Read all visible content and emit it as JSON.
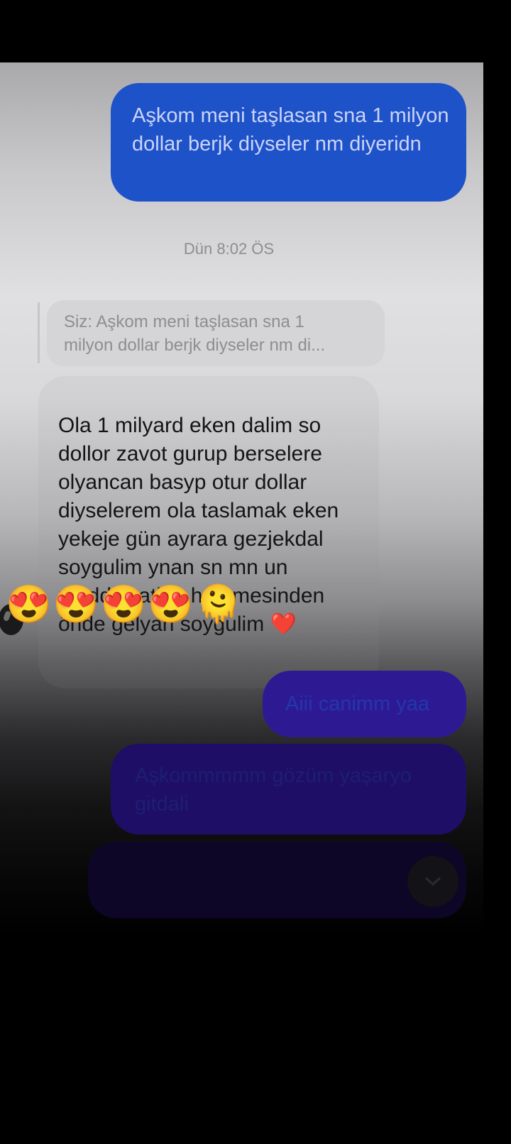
{
  "messages": {
    "first_sent": "Aşkom meni taşlasan sna 1 milyon dollar berjk diyseler nm diyeridn",
    "timestamp": "Dün 8:02 ÖS",
    "reply_preview": "Siz: Aşkom meni taşlasan sna 1\nmilyon dollar berjk diyseler nm di...",
    "received": "Ola 1 milyard eken dalim so\ndollor zavot gurup berselere\nolyancan basyp otur dollar\ndiyselerem ola taslamak eken\nyekeje gün ayrara gezjekdal\nsoygulim ynan sn mn un\nmaddy zatlan hemmesinden\nönde gelyan soygulim ❤️",
    "reactions": "😍😍😍😍🫠",
    "sent_2": "Aiii canimm yaa",
    "sent_3": "Aşkommmmm gözüm yaşaryo gitdali"
  },
  "colors": {
    "sent_bubble": "#1d52c9",
    "received_text": "#141414",
    "background": "#000000"
  },
  "icons": {
    "scroll_down": "chevron-down-icon",
    "avatar": "avatar"
  }
}
